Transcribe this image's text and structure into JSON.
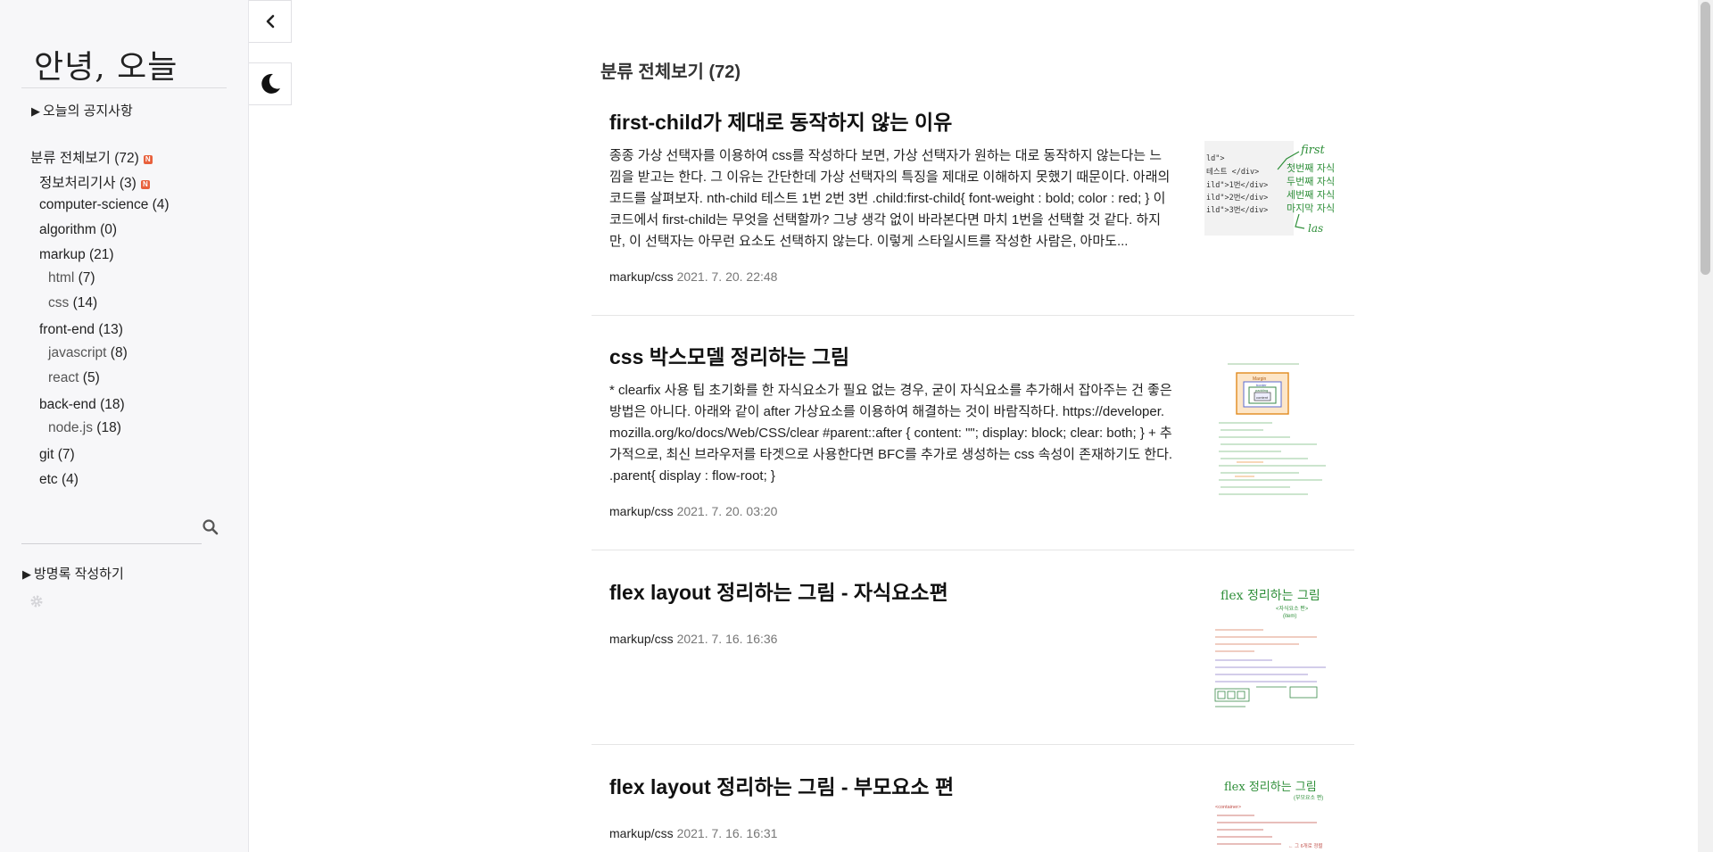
{
  "sidebar": {
    "blog_title": "안녕, 오늘",
    "notice": "오늘의 공지사항",
    "categories": [
      {
        "name": "분류 전체보기",
        "count": "(72)",
        "new": true
      },
      {
        "name": "정보처리기사",
        "count": "(3)",
        "new": true
      },
      {
        "name": "computer-science",
        "count": "(4)"
      },
      {
        "name": "algorithm",
        "count": "(0)"
      },
      {
        "name": "markup",
        "count": "(21)"
      },
      {
        "name": "html",
        "count": "(7)"
      },
      {
        "name": "css",
        "count": "(14)"
      },
      {
        "name": "front-end",
        "count": "(13)"
      },
      {
        "name": "javascript",
        "count": "(8)"
      },
      {
        "name": "react",
        "count": "(5)"
      },
      {
        "name": "back-end",
        "count": "(18)"
      },
      {
        "name": "node.js",
        "count": "(18)"
      },
      {
        "name": "git",
        "count": "(7)"
      },
      {
        "name": "etc",
        "count": "(4)"
      }
    ],
    "new_badge": "N",
    "search_placeholder": "",
    "guestbook": "방명록 작성하기"
  },
  "main": {
    "heading": "분류 전체보기 (72)",
    "posts": [
      {
        "title": "first-child가 제대로 동작하지 않는 이유",
        "excerpt": "종종 가상 선택자를 이용하여 css를 작성하다 보면, 가상 선택자가 원하는 대로 동작하지 않는다는 느낌을 받고는 한다. 그 이유는 간단한데 가상 선택자의 특징을 제대로 이해하지 못했기 때문이다. 아래의 코드를 살펴보자. nth-child 테스트 1번 2번 3번 .child:first-child{ font-weight : bold; color : red; } 이 코드에서 first-child는 무엇을 선택할까? 그냥 생각 없이 바라본다면 마치 1번을 선택할 것 같다. 하지만, 이 선택자는 아무런 요소도 선택하지 않는다. 이렇게 스타일시트를 작성한 사람은, 아마도...",
        "category": "markup/css",
        "date": "2021. 7. 20. 22:48"
      },
      {
        "title": "css 박스모델 정리하는 그림",
        "excerpt": "* clearfix 사용 팁 초기화를 한 자식요소가 필요 없는 경우, 굳이 자식요소를 추가해서 잡아주는 건 좋은 방법은 아니다. 아래와 같이 after 가상요소를 이용하여 해결하는 것이 바람직하다. https://developer.mozilla.org/ko/docs/Web/CSS/clear #parent::after { content: \"\"; display: block; clear: both; } + 추가적으로, 최신 브라우저를 타겟으로 사용한다면 BFC를 추가로 생성하는 css 속성이 존재하기도 한다. .parent{ display : flow-root; }",
        "category": "markup/css",
        "date": "2021. 7. 20. 03:20"
      },
      {
        "title": "flex layout 정리하는 그림 - 자식요소편",
        "excerpt": "",
        "category": "markup/css",
        "date": "2021. 7. 16. 16:36"
      },
      {
        "title": "flex layout 정리하는 그림 - 부모요소 편",
        "excerpt": "",
        "category": "markup/css",
        "date": "2021. 7. 16. 16:31"
      }
    ]
  },
  "thumbs": {
    "t1": {
      "first": "first",
      "l1": "첫번째 자식",
      "l2": "두번째 자식",
      "l3": "세번째 자식",
      "l4": "마지막 자식",
      "last": "las",
      "c0": "ld\">",
      "c1": "테스트 </div>",
      "c2": "ild\">1번</div>",
      "c3": "ild\">2번</div>",
      "c4": "ild\">3번</div>"
    },
    "t2": {
      "margin": "Margin",
      "border": "border",
      "padding": "padding",
      "content": "content"
    },
    "t3": {
      "title": "flex 정리하는 그림",
      "sub": "<자식요소 편>",
      "sub2": "(item)"
    },
    "t4": {
      "title": "flex 정리하는 그림",
      "sub": "(부모요소 편)",
      "cont": "<container>",
      "last": "← 그 6개로 정렬"
    }
  },
  "colors": {
    "accent_badge": "#e8603c",
    "sidebar_bg": "#f7f7f9",
    "thumb_green": "#2f8f3a",
    "thumb_orange": "#e08a1e"
  }
}
